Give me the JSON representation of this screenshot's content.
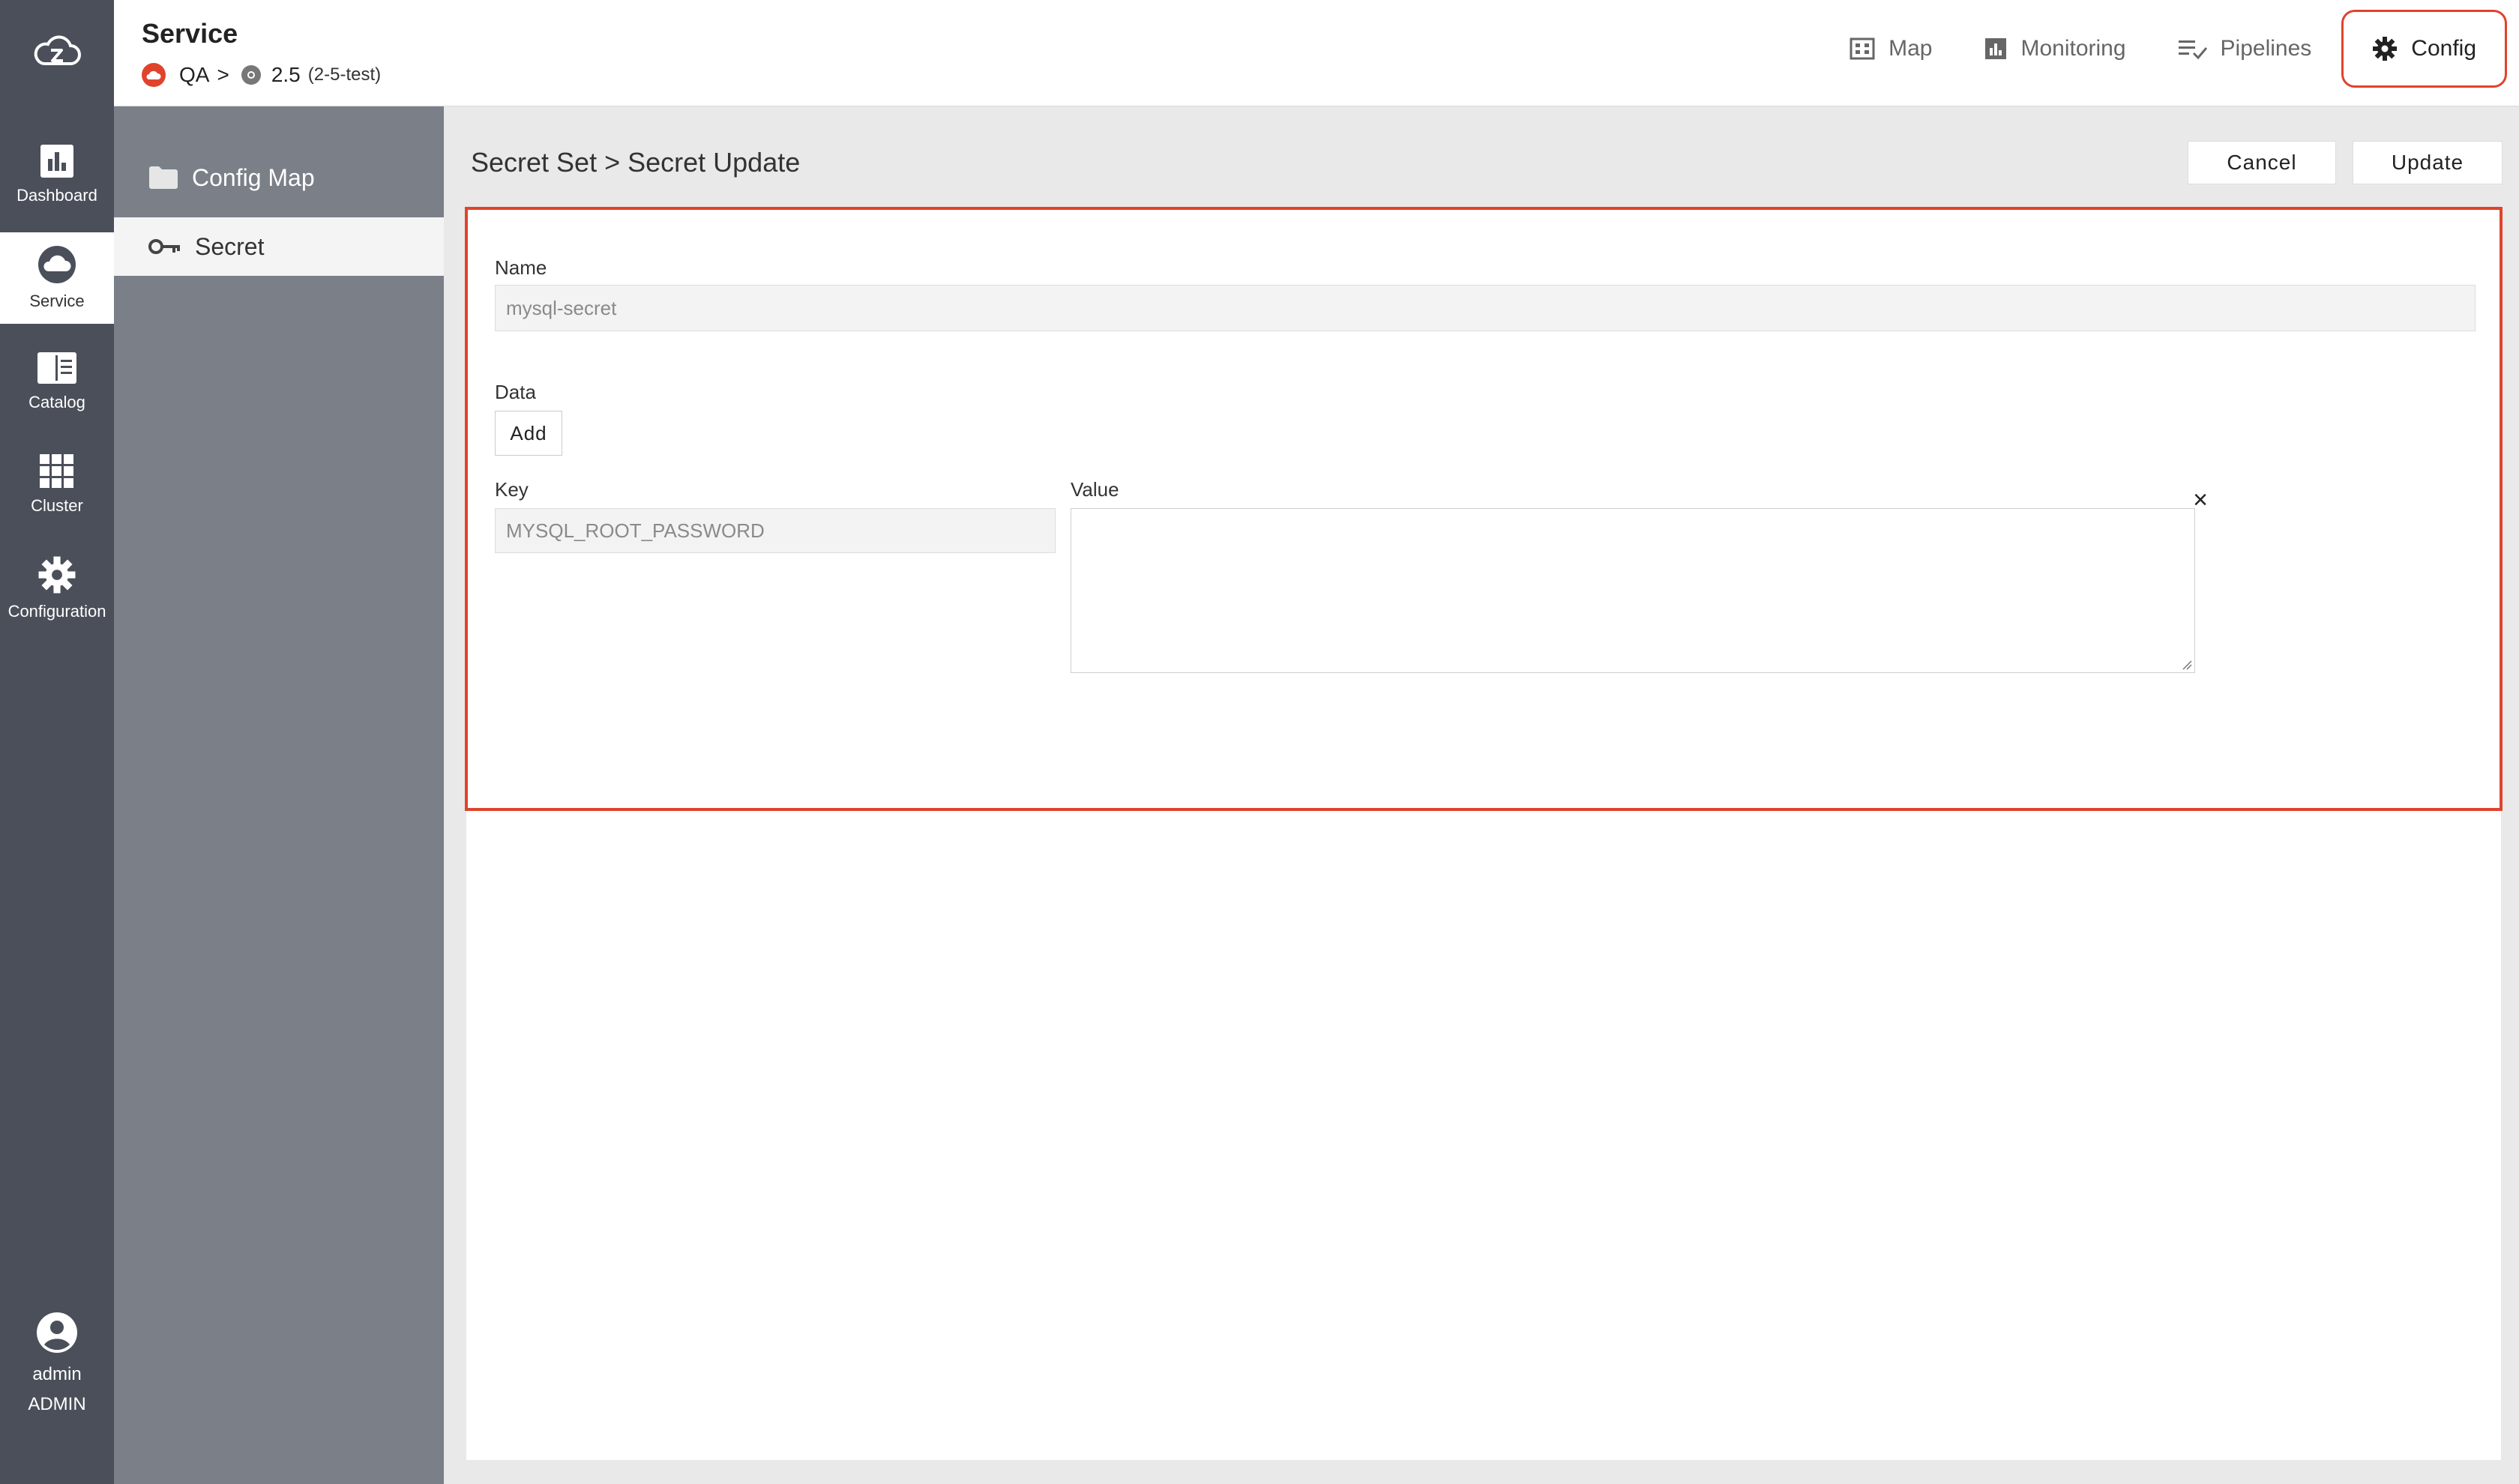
{
  "header": {
    "title": "Service",
    "breadcrumb": {
      "project": "QA",
      "separator": ">",
      "version": "2.5",
      "version_tag": "(2-5-test)"
    },
    "tabs": [
      {
        "label": "Map",
        "icon": "map-icon"
      },
      {
        "label": "Monitoring",
        "icon": "bar-chart-icon"
      },
      {
        "label": "Pipelines",
        "icon": "checklist-icon"
      },
      {
        "label": "Config",
        "icon": "gear-icon",
        "active": true
      }
    ]
  },
  "rail": {
    "items": [
      {
        "label": "Dashboard",
        "icon": "bar-chart-icon"
      },
      {
        "label": "Service",
        "icon": "cloud-icon",
        "active": true
      },
      {
        "label": "Catalog",
        "icon": "catalog-icon"
      },
      {
        "label": "Cluster",
        "icon": "grid-icon"
      },
      {
        "label": "Configuration",
        "icon": "gear-icon"
      }
    ],
    "user": {
      "name": "admin",
      "role": "ADMIN"
    }
  },
  "subnav": {
    "items": [
      {
        "label": "Config Map",
        "icon": "folder-icon"
      },
      {
        "label": "Secret",
        "icon": "key-icon",
        "active": true
      }
    ]
  },
  "main": {
    "heading": "Secret Set > Secret Update",
    "cancel_label": "Cancel",
    "update_label": "Update",
    "form": {
      "name_label": "Name",
      "name_value": "mysql-secret",
      "data_label": "Data",
      "add_label": "Add",
      "key_label": "Key",
      "key_value": "MYSQL_ROOT_PASSWORD",
      "value_label": "Value",
      "value_value": "",
      "remove_symbol": "×"
    }
  },
  "colors": {
    "accent": "#e0432b",
    "rail_bg": "#4a4f5a",
    "subnav_bg": "#7a7f88"
  }
}
